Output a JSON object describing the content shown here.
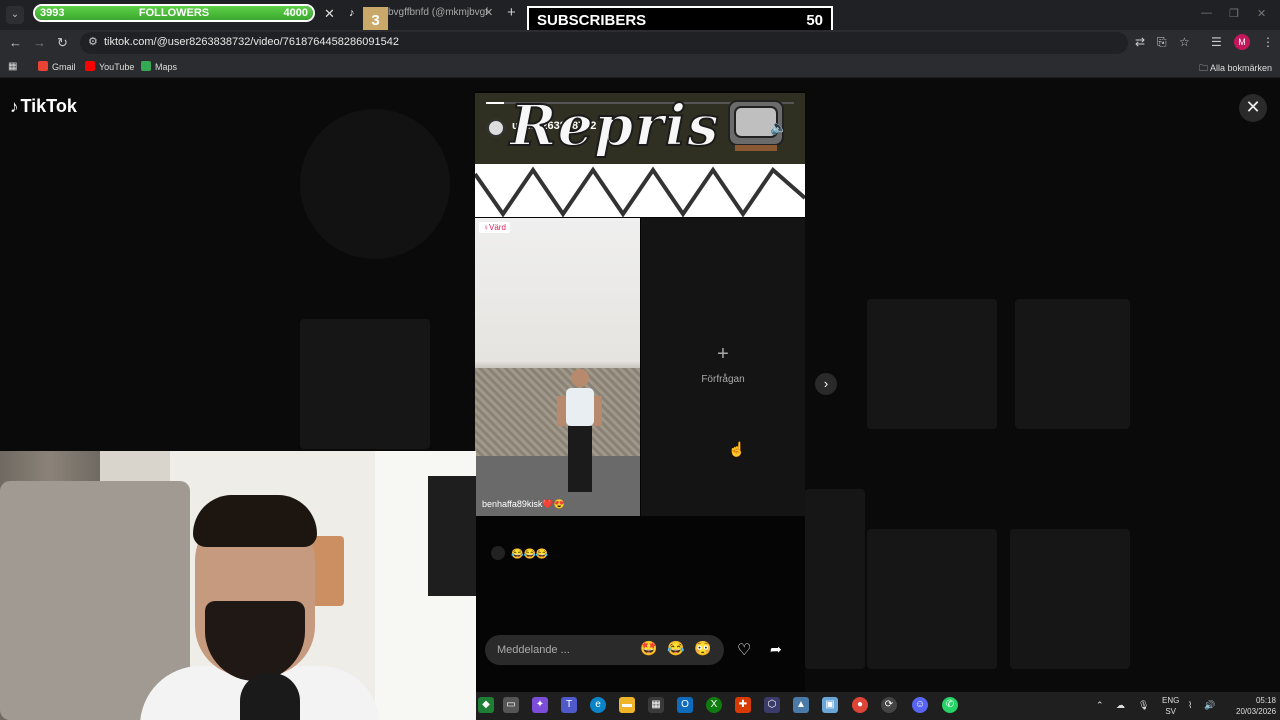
{
  "overlay": {
    "followers": {
      "current": "3993",
      "label": "FOLLOWERS",
      "goal": "4000",
      "progress": 0.9983
    },
    "subscribers": {
      "label": "SUBSCRIBERS",
      "count": "50"
    },
    "subscriber_tab_number": "3"
  },
  "browser": {
    "tab2_title": "bvgffbnfd (@mkmjbvgffb",
    "url": "tiktok.com/@user8263838732/video/7618764458286091542",
    "avatar_letter": "M",
    "bookmarks": [
      {
        "label": "Gmail",
        "color": "#ea4335"
      },
      {
        "label": "YouTube",
        "color": "#ff0000"
      },
      {
        "label": "Maps",
        "color": "#34a853"
      }
    ],
    "all_bookmarks": "Alla bokmärken"
  },
  "tiktok": {
    "logo": "TikTok",
    "live": {
      "host_name": "user8263838732",
      "banner_text": "Repris",
      "guest_badge": "Värd",
      "guest_name": "benhaffa89kisk❤️😍",
      "request_label": "Förfrågan",
      "chat_message": "😂😂😂",
      "message_placeholder": "Meddelande ...",
      "reactions": [
        "🤩",
        "😂",
        "😳"
      ]
    }
  },
  "taskbar": {
    "lang_top": "ENG",
    "lang_bottom": "SV",
    "time": "05:18",
    "date": "20/03/2026"
  }
}
